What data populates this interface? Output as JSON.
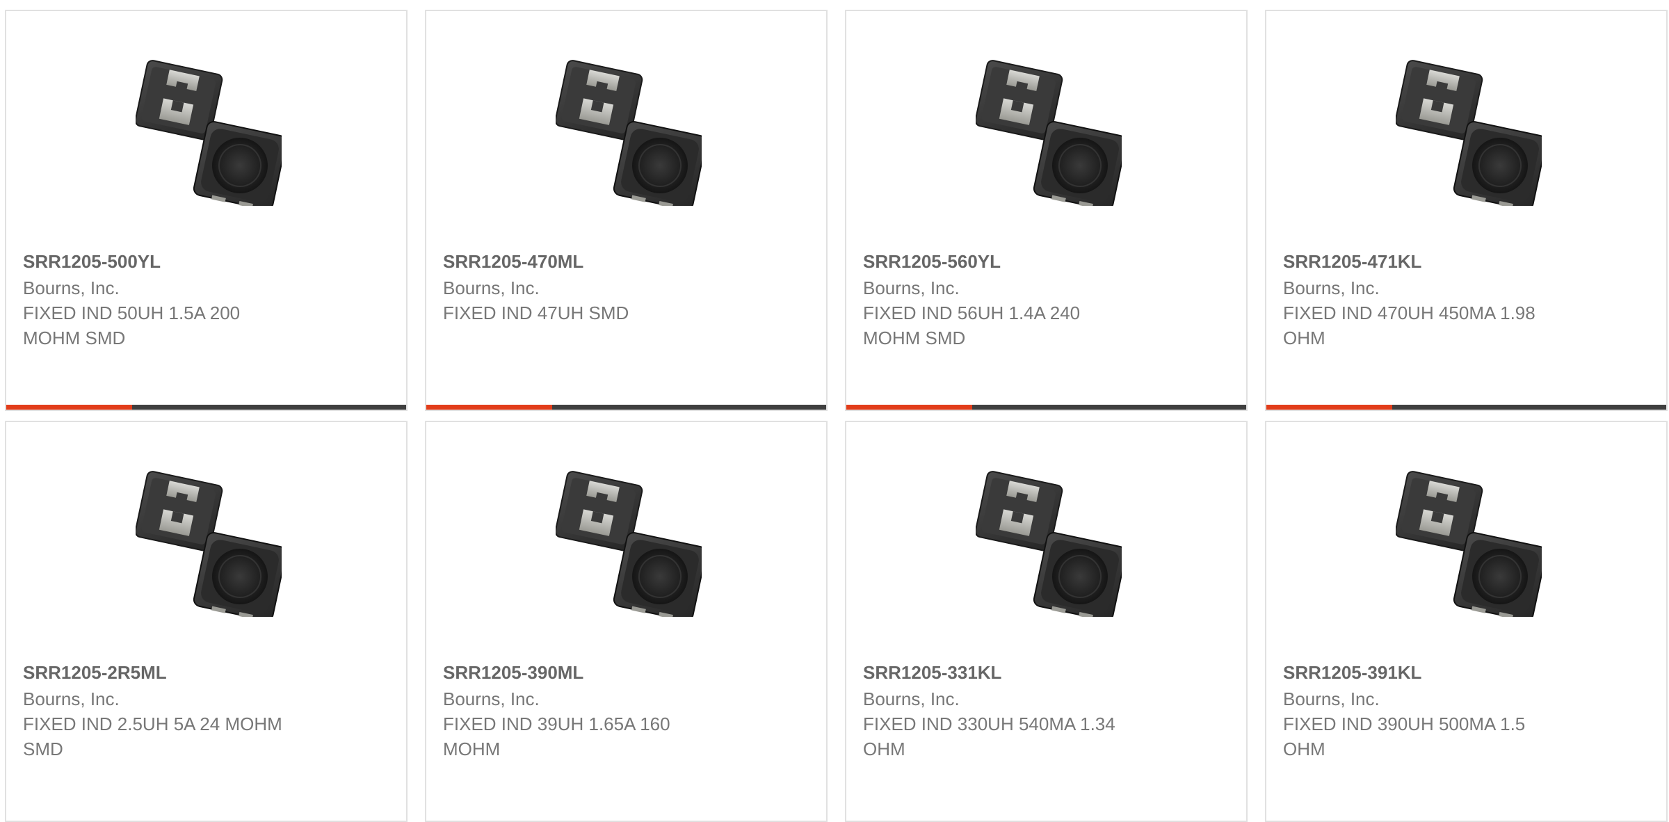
{
  "colors": {
    "accent": "#e23d1a",
    "bar": "#3f3f3f",
    "text": "#777777",
    "border": "#e1e1e1"
  },
  "products": [
    {
      "part": "SRR1205-500YL",
      "manufacturer": "Bourns, Inc.",
      "description": "FIXED IND 50UH 1.5A 200 MOHM SMD",
      "image": "inductor-product-photo",
      "accent_fraction": 0.315
    },
    {
      "part": "SRR1205-470ML",
      "manufacturer": "Bourns, Inc.",
      "description": "FIXED IND 47UH SMD",
      "image": "inductor-product-photo",
      "accent_fraction": 0.315
    },
    {
      "part": "SRR1205-560YL",
      "manufacturer": "Bourns, Inc.",
      "description": "FIXED IND 56UH 1.4A 240 MOHM SMD",
      "image": "inductor-product-photo",
      "accent_fraction": 0.315
    },
    {
      "part": "SRR1205-471KL",
      "manufacturer": "Bourns, Inc.",
      "description": "FIXED IND 470UH 450MA 1.98 OHM",
      "image": "inductor-product-photo",
      "accent_fraction": 0.315
    },
    {
      "part": "SRR1205-2R5ML",
      "manufacturer": "Bourns, Inc.",
      "description": "FIXED IND 2.5UH 5A 24 MOHM SMD",
      "image": "inductor-product-photo"
    },
    {
      "part": "SRR1205-390ML",
      "manufacturer": "Bourns, Inc.",
      "description": "FIXED IND 39UH 1.65A 160 MOHM",
      "image": "inductor-product-photo"
    },
    {
      "part": "SRR1205-331KL",
      "manufacturer": "Bourns, Inc.",
      "description": "FIXED IND 330UH 540MA 1.34 OHM",
      "image": "inductor-product-photo"
    },
    {
      "part": "SRR1205-391KL",
      "manufacturer": "Bourns, Inc.",
      "description": "FIXED IND 390UH 500MA 1.5 OHM",
      "image": "inductor-product-photo"
    }
  ]
}
